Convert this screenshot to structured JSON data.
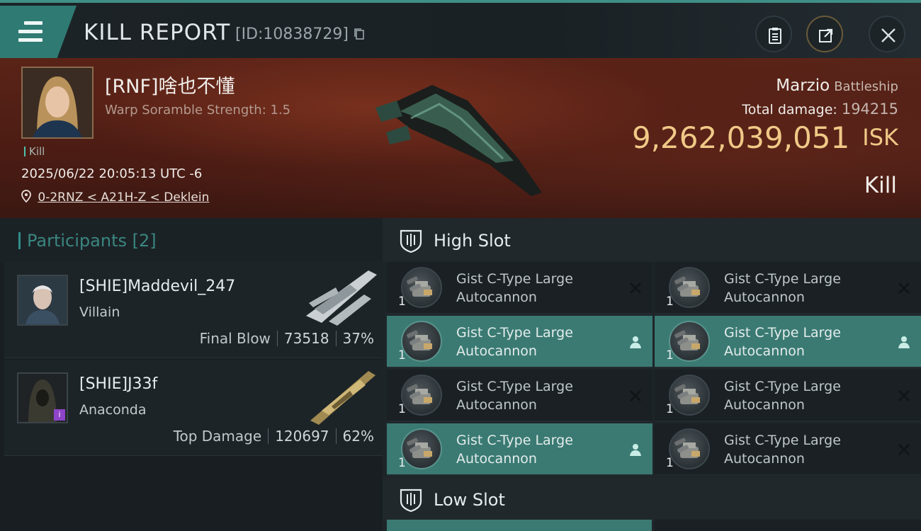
{
  "header": {
    "title": "KILL REPORT",
    "report_id": "[ID:10838729]",
    "icons": [
      "menu-icon",
      "copy-icon",
      "clipboard-icon",
      "share-icon",
      "close-icon"
    ]
  },
  "victim": {
    "name": "[RNF]啥也不懂",
    "warp_scramble": "Warp Soramble Strength: 1.5",
    "tag": "Kill",
    "timestamp": "2025/06/22 20:05:13 UTC -6",
    "location": "0-2RNZ < A21H-Z < Deklein",
    "ship_name": "Marzio",
    "ship_class": "Battleship",
    "total_damage_label": "Total damage:",
    "total_damage": "194215",
    "isk_value": "9,262,039,051",
    "isk_label": "ISK",
    "result": "Kill"
  },
  "participants": {
    "header": "Participants",
    "count": "[2]",
    "rows": [
      {
        "name": "[SHIE]Maddevil_247",
        "ship": "Villain",
        "label": "Final Blow",
        "damage": "73518",
        "percent": "37%"
      },
      {
        "name": "[SHIE]J33f",
        "ship": "Anaconda",
        "label": "Top Damage",
        "damage": "120697",
        "percent": "62%"
      }
    ]
  },
  "slots": {
    "high": {
      "label": "High Slot",
      "modules": [
        {
          "qty": "1",
          "line1": "Gist C-Type Large",
          "line2": "Autocannon",
          "status": "destroyed"
        },
        {
          "qty": "1",
          "line1": "Gist C-Type Large",
          "line2": "Autocannon",
          "status": "destroyed"
        },
        {
          "qty": "1",
          "line1": "Gist C-Type Large",
          "line2": "Autocannon",
          "status": "dropped"
        },
        {
          "qty": "1",
          "line1": "Gist C-Type Large",
          "line2": "Autocannon",
          "status": "dropped"
        },
        {
          "qty": "1",
          "line1": "Gist C-Type Large",
          "line2": "Autocannon",
          "status": "destroyed"
        },
        {
          "qty": "1",
          "line1": "Gist C-Type Large",
          "line2": "Autocannon",
          "status": "destroyed"
        },
        {
          "qty": "1",
          "line1": "Gist C-Type Large",
          "line2": "Autocannon",
          "status": "dropped"
        },
        {
          "qty": "1",
          "line1": "Gist C-Type Large",
          "line2": "Autocannon",
          "status": "destroyed"
        }
      ]
    },
    "low": {
      "label": "Low Slot"
    }
  },
  "colors": {
    "accent": "#3a7a73",
    "isk": "#f0c987",
    "hero_bg": "#4a1c14"
  }
}
